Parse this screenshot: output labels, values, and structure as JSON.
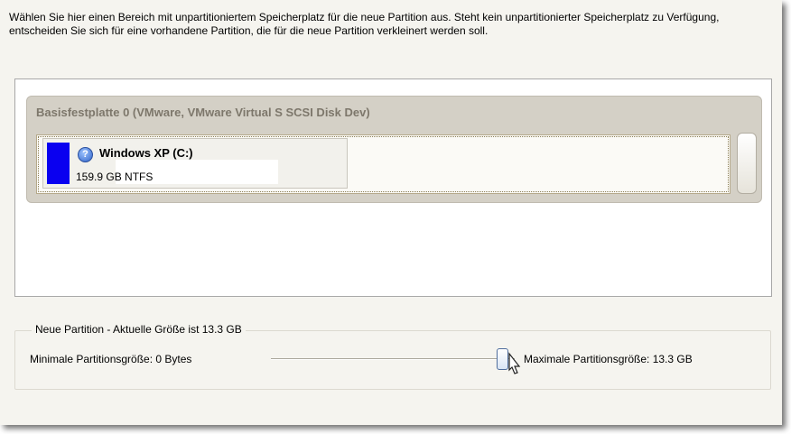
{
  "intro_text": "Wählen Sie hier einen Bereich mit unpartitioniertem Speicherplatz für die neue Partition aus. Steht kein unpartitionierter Speicherplatz zu Verfügung, entscheiden Sie sich für eine vorhandene Partition, die für die neue Partition verkleinert werden soll.",
  "disk": {
    "title": "Basisfestplatte 0 (VMware, VMware Virtual S SCSI Disk Dev)",
    "partition": {
      "name": "Windows XP (C:)",
      "info": "159.9 GB NTFS",
      "color": "#0a00f0",
      "icon": "help-icon"
    }
  },
  "new_partition": {
    "legend": "Neue Partition - Aktuelle Größe ist 13.3 GB",
    "min_label": "Minimale Partitionsgröße:   0 Bytes",
    "max_label": "Maximale Partitionsgröße:   13.3 GB",
    "slider_value_fraction": 1.0
  }
}
